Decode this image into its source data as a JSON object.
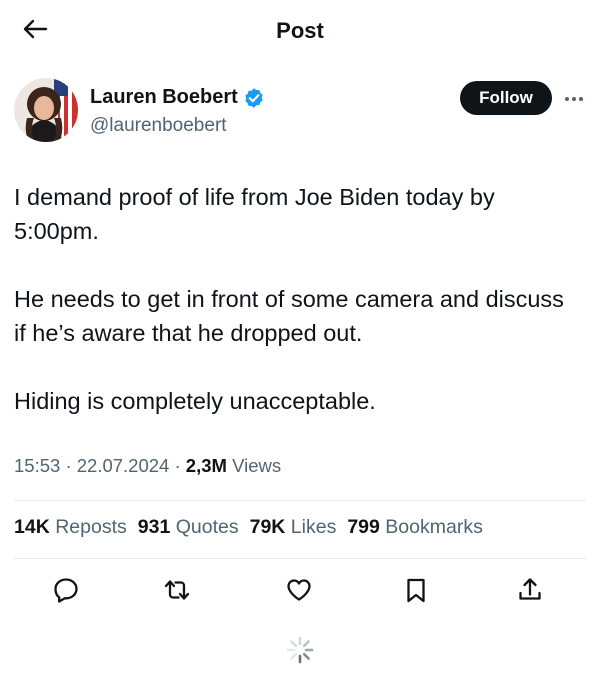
{
  "header": {
    "title": "Post"
  },
  "author": {
    "name": "Lauren Boebert",
    "handle": "@laurenboebert",
    "follow_label": "Follow"
  },
  "post": {
    "paragraphs": [
      "I demand proof of life from Joe Biden today by 5:00pm.",
      "He needs to get in front of some camera and discuss if he’s aware that he dropped out.",
      "Hiding is completely unacceptable."
    ],
    "time": "15:53",
    "date": "22.07.2024",
    "separator": "·",
    "views_count": "2,3M",
    "views_label": "Views"
  },
  "stats": [
    {
      "count": "14K",
      "label": "Reposts"
    },
    {
      "count": "931",
      "label": "Quotes"
    },
    {
      "count": "79K",
      "label": "Likes"
    },
    {
      "count": "799",
      "label": "Bookmarks"
    }
  ],
  "actions": [
    "reply-icon",
    "repost-icon",
    "like-icon",
    "bookmark-icon",
    "share-icon"
  ],
  "colors": {
    "text": "#0f1419",
    "secondary": "#536471",
    "verified": "#1d9bf0",
    "follow_bg": "#0f1419",
    "divider": "#e6ecf0"
  }
}
